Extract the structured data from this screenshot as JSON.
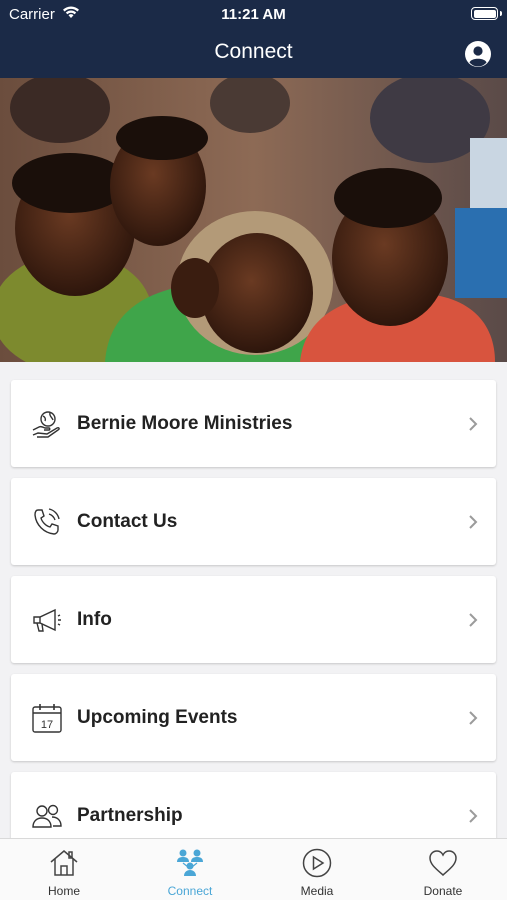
{
  "status_bar": {
    "carrier": "Carrier",
    "time": "11:21 AM"
  },
  "nav": {
    "title": "Connect"
  },
  "hero": {
    "image": "children-smiling-photo"
  },
  "menu": {
    "items": [
      {
        "label": "Bernie Moore Ministries",
        "icon": "globe-hand-icon"
      },
      {
        "label": "Contact Us",
        "icon": "phone-icon"
      },
      {
        "label": "Info",
        "icon": "megaphone-icon"
      },
      {
        "label": "Upcoming Events",
        "icon": "calendar-icon",
        "calendar_day": "17"
      },
      {
        "label": "Partnership",
        "icon": "people-icon"
      }
    ]
  },
  "tabs": [
    {
      "label": "Home",
      "icon": "home-icon"
    },
    {
      "label": "Connect",
      "icon": "connect-icon",
      "active": true
    },
    {
      "label": "Media",
      "icon": "play-icon"
    },
    {
      "label": "Donate",
      "icon": "heart-icon"
    }
  ],
  "colors": {
    "nav_bg": "#1b2a47",
    "accent": "#4aa6d6",
    "background": "#f2f2f4"
  }
}
